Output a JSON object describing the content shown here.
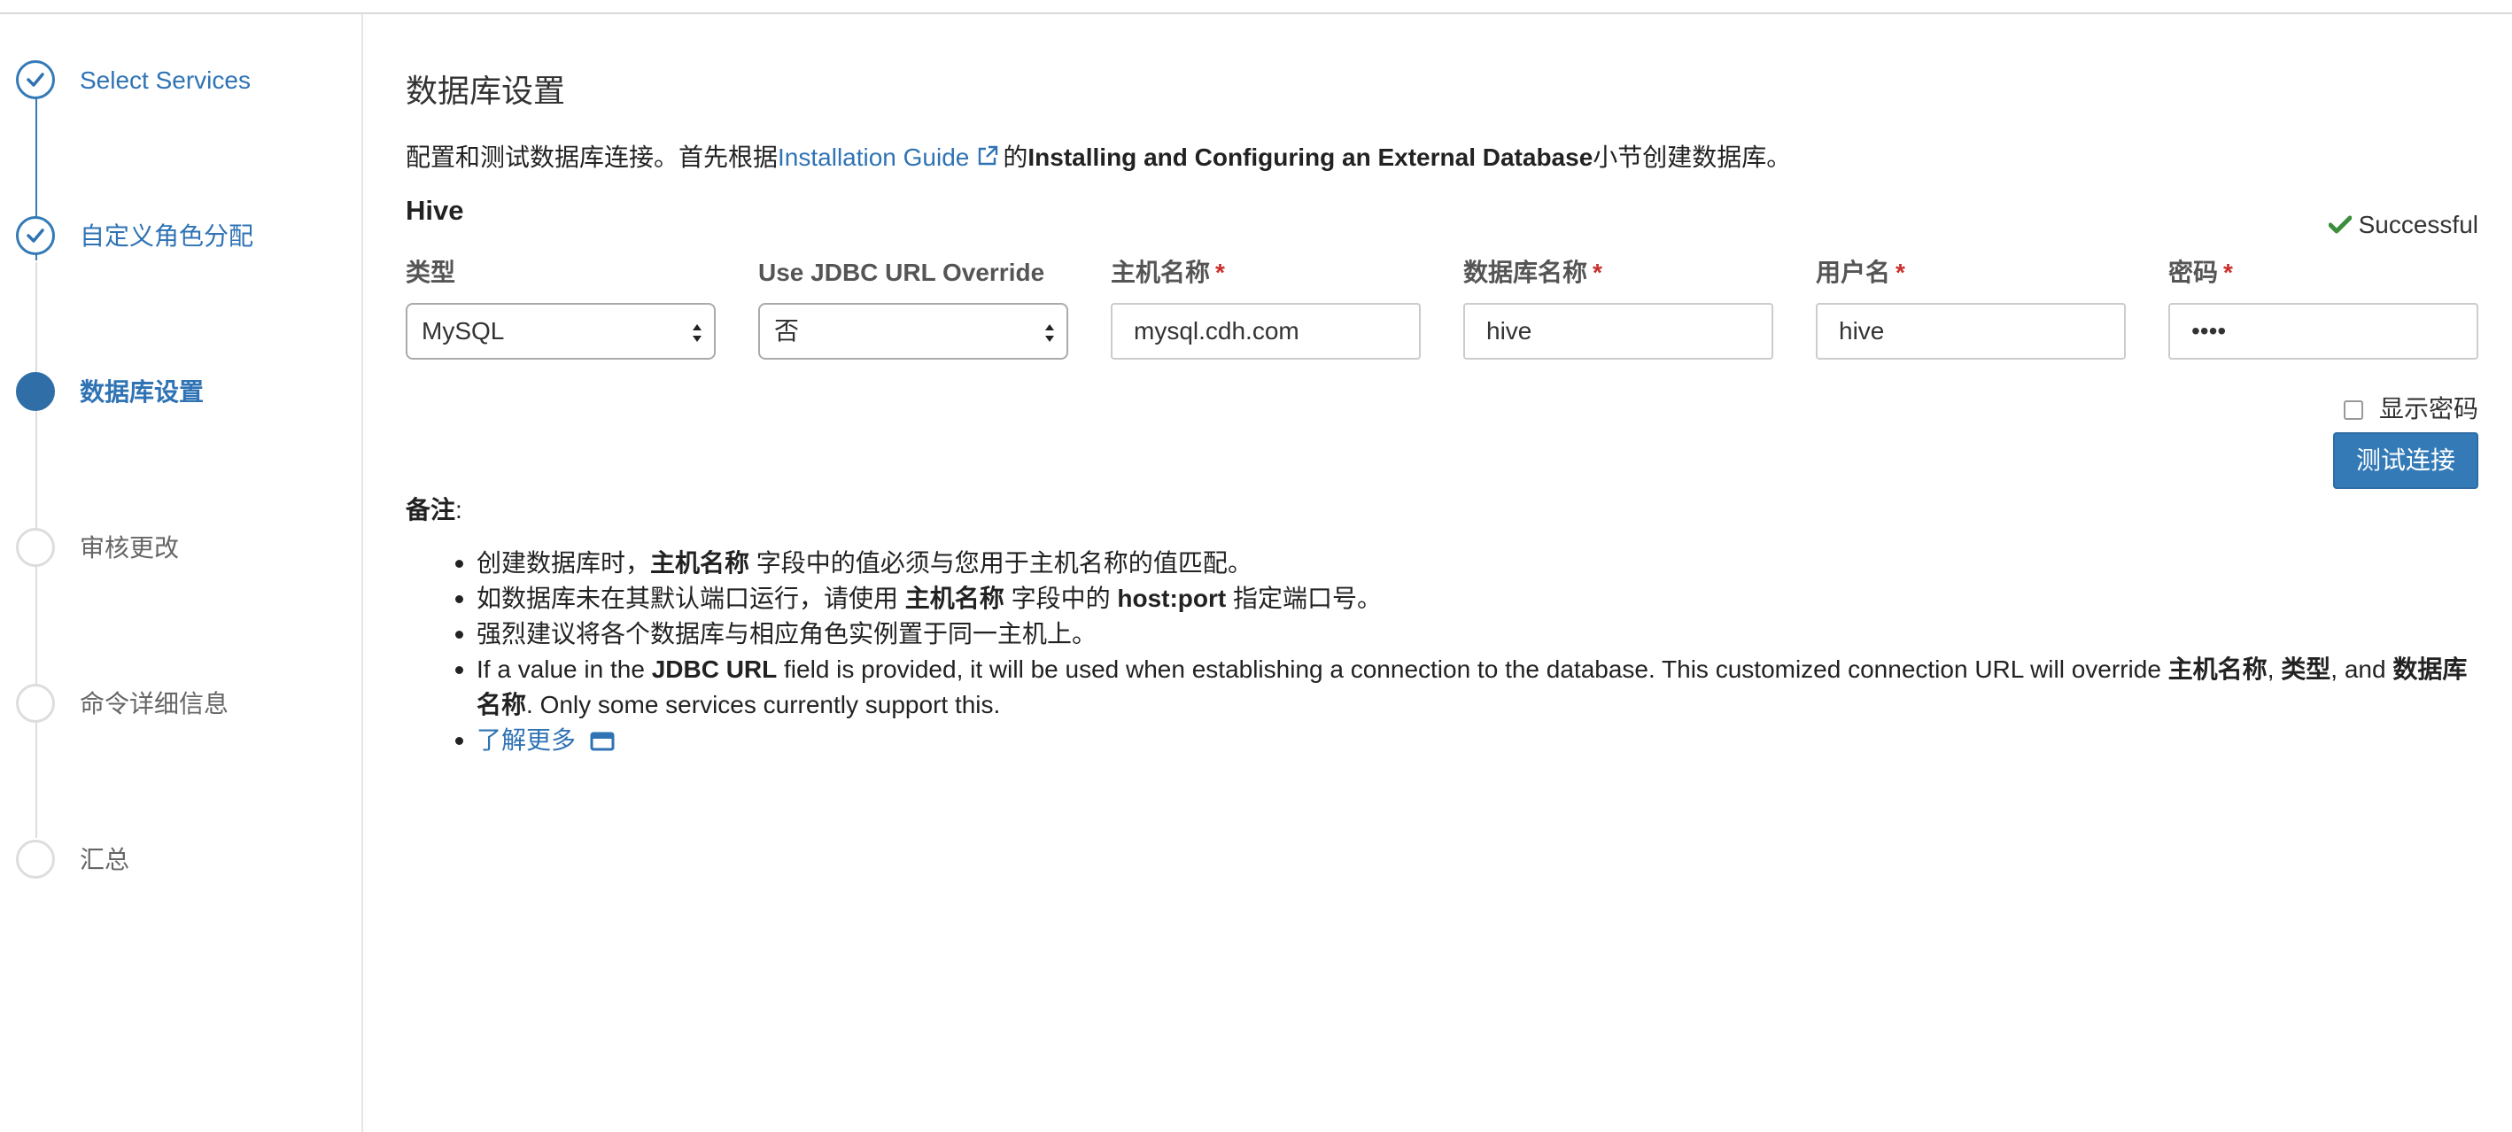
{
  "steps": [
    {
      "label": "Select Services",
      "state": "done"
    },
    {
      "label": "自定义角色分配",
      "state": "done"
    },
    {
      "label": "数据库设置",
      "state": "current"
    },
    {
      "label": "审核更改",
      "state": "todo"
    },
    {
      "label": "命令详细信息",
      "state": "todo"
    },
    {
      "label": "汇总",
      "state": "todo"
    }
  ],
  "page": {
    "title": "数据库设置",
    "intro_prefix": "配置和测试数据库连接。首先根据",
    "intro_link": "Installation Guide",
    "intro_mid": "的",
    "intro_bold": "Installing and Configuring an External Database",
    "intro_suffix": "小节创建数据库。"
  },
  "service": {
    "name": "Hive",
    "status": "Successful",
    "status_color": "#3c8d3c"
  },
  "fields": {
    "type": {
      "label": "类型",
      "value": "MySQL"
    },
    "jdbc_override": {
      "label": "Use JDBC URL Override",
      "value": "否"
    },
    "hostname": {
      "label": "主机名称",
      "required": "*",
      "value": "mysql.cdh.com"
    },
    "db_name": {
      "label": "数据库名称",
      "required": "*",
      "value": "hive"
    },
    "username": {
      "label": "用户名",
      "required": "*",
      "value": "hive"
    },
    "password": {
      "label": "密码",
      "required": "*",
      "value": "••••"
    }
  },
  "show_password_label": "显示密码",
  "test_button": "测试连接",
  "notes": {
    "title": "备注",
    "colon": ":",
    "item1": {
      "a": "创建数据库时，",
      "b": "主机名称",
      "c": " 字段中的值必须与您用于主机名称的值匹配。"
    },
    "item2": {
      "a": "如数据库未在其默认端口运行，请使用 ",
      "b": "主机名称",
      "c": " 字段中的 ",
      "d": "host:port",
      "e": " 指定端口号。"
    },
    "item3": "强烈建议将各个数据库与相应角色实例置于同一主机上。",
    "item4": {
      "a": "If a value in the ",
      "b": "JDBC URL",
      "c": " field is provided, it will be used when establishing a connection to the database. This customized connection URL will override ",
      "d": "主机名称",
      "e": ", ",
      "f": "类型",
      "g": ", and ",
      "h": "数据库名称",
      "i": ". Only some services currently support this."
    },
    "learn_more": "了解更多"
  },
  "colors": {
    "link": "#2f73b4",
    "primary_button": "#337ab7",
    "required": "#c9302c"
  }
}
